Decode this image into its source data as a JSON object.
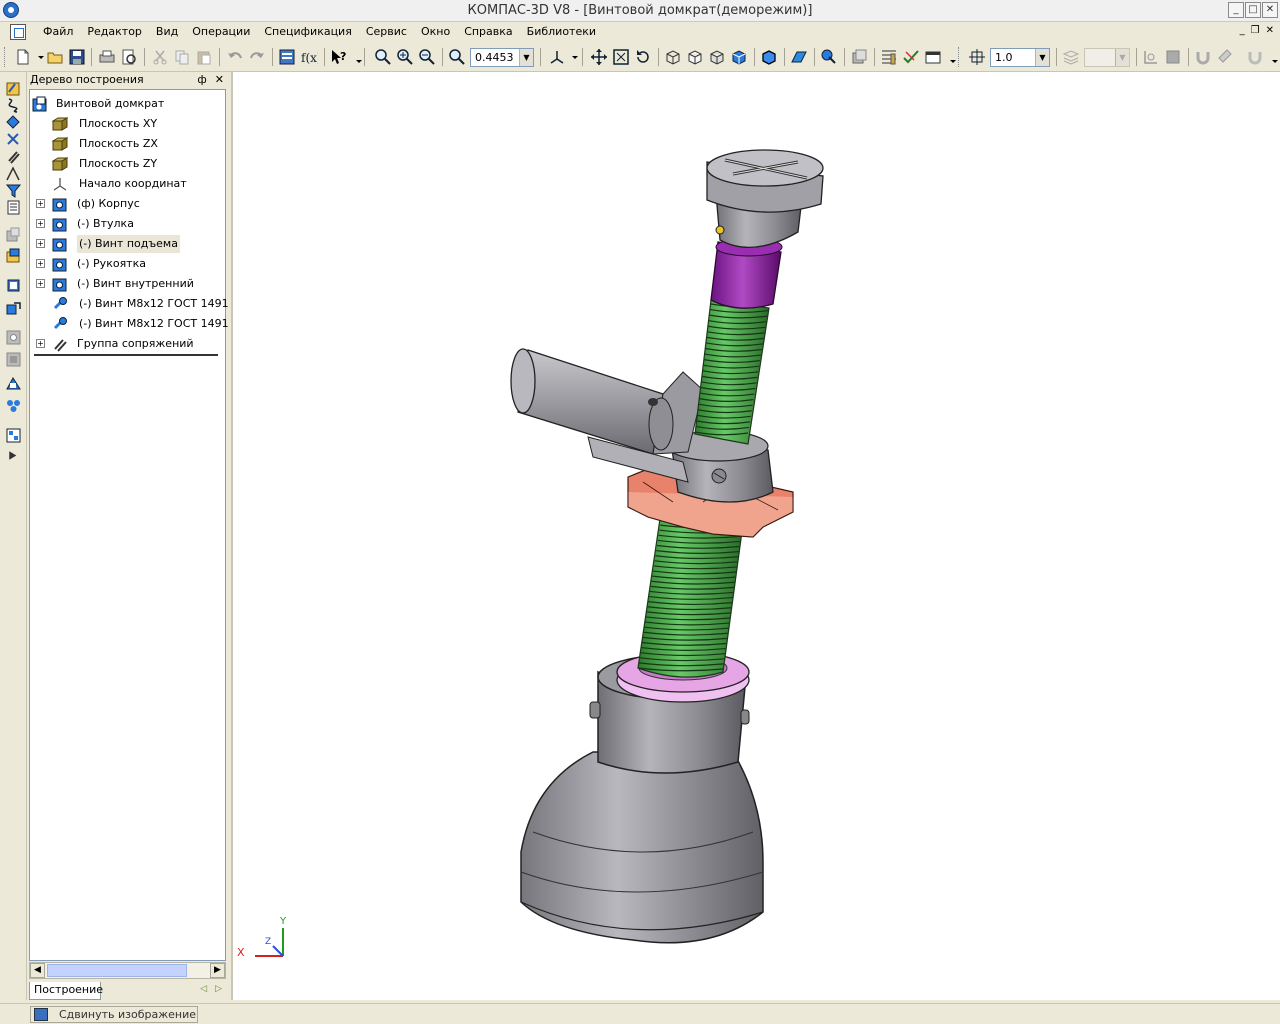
{
  "window": {
    "title": "КОМПАС-3D V8 - [Винтовой домкрат(деморежим)]"
  },
  "menu": {
    "items": [
      "Файл",
      "Редактор",
      "Вид",
      "Операции",
      "Спецификация",
      "Сервис",
      "Окно",
      "Справка",
      "Библиотеки"
    ]
  },
  "toolbar": {
    "zoom_value": "0.4453",
    "step_value": "1.0",
    "style_value": ""
  },
  "tree": {
    "header": "Дерево построения",
    "pin_label": "Ф",
    "close_label": "✕",
    "root": "Винтовой домкрат",
    "items": [
      {
        "label": "Плоскость XY",
        "icon": "plane-icon",
        "expandable": false
      },
      {
        "label": "Плоскость ZX",
        "icon": "plane-icon",
        "expandable": false
      },
      {
        "label": "Плоскость ZY",
        "icon": "plane-icon",
        "expandable": false
      },
      {
        "label": "Начало координат",
        "icon": "origin-icon",
        "expandable": false
      },
      {
        "label": "(ф) Корпус",
        "icon": "part-icon",
        "expandable": true
      },
      {
        "label": "(-) Втулка",
        "icon": "part-icon",
        "expandable": true
      },
      {
        "label": "(-) Винт подъема",
        "icon": "part-icon",
        "expandable": true,
        "highlighted": true
      },
      {
        "label": "(-) Рукоятка",
        "icon": "part-icon",
        "expandable": true
      },
      {
        "label": "(-) Винт внутренний",
        "icon": "part-icon",
        "expandable": true
      },
      {
        "label": "(-) Винт М8х12 ГОСТ 1491",
        "icon": "screw-icon",
        "expandable": false
      },
      {
        "label": "(-) Винт М8х12 ГОСТ 1491",
        "icon": "screw-icon",
        "expandable": false
      },
      {
        "label": "Группа сопряжений",
        "icon": "mates-icon",
        "expandable": true
      }
    ],
    "tab_label": "Построение"
  },
  "axis_triad": {
    "x_label": "X",
    "y_label": "Y",
    "z_label": "Z"
  },
  "status": {
    "text": "Сдвинуть изображение"
  },
  "colors": {
    "thread_green": "#3fa23f",
    "collar_purple": "#8b1e9e",
    "nut_orange": "#e8826a",
    "body_gray": "#8e8e94",
    "ring_pink": "#e6a6e6"
  }
}
